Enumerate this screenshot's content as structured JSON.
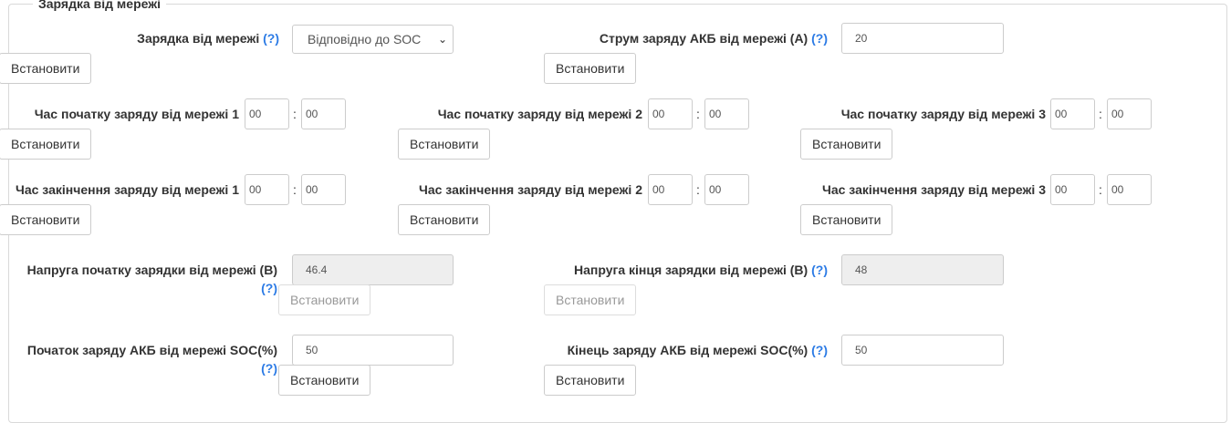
{
  "section": {
    "title": "Зарядка від мережі"
  },
  "help_mark": "(?)",
  "set_label": "Встановити",
  "time_separator": ":",
  "grid_charge": {
    "label": "Зарядка від мережі",
    "selected": "Відповідно до SOC"
  },
  "charge_current": {
    "label": "Струм заряду АКБ від мережі (А)",
    "value": "20"
  },
  "start_times": [
    {
      "label": "Час початку заряду від мережі 1",
      "hours": "00",
      "minutes": "00"
    },
    {
      "label": "Час початку заряду від мережі 2",
      "hours": "00",
      "minutes": "00"
    },
    {
      "label": "Час початку заряду від мережі 3",
      "hours": "00",
      "minutes": "00"
    }
  ],
  "end_times": [
    {
      "label": "Час закінчення заряду від мережі 1",
      "hours": "00",
      "minutes": "00"
    },
    {
      "label": "Час закінчення заряду від мережі 2",
      "hours": "00",
      "minutes": "00"
    },
    {
      "label": "Час закінчення заряду від мережі 3",
      "hours": "00",
      "minutes": "00"
    }
  ],
  "voltage_start": {
    "label": "Напруга початку зарядки від мережі (В)",
    "value": "46.4"
  },
  "voltage_end": {
    "label": "Напруга кінця зарядки від мережі (В)",
    "value": "48"
  },
  "soc_start": {
    "label": "Початок заряду АКБ від мережі SOC(%)",
    "value": "50"
  },
  "soc_end": {
    "label": "Кінець заряду АКБ від мережі SOC(%)",
    "value": "50"
  }
}
